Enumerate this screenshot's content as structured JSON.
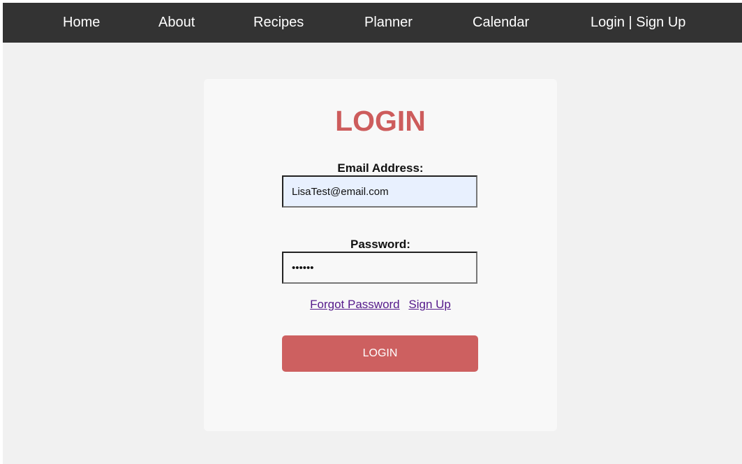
{
  "nav": {
    "items": [
      {
        "label": "Home"
      },
      {
        "label": "About"
      },
      {
        "label": "Recipes"
      },
      {
        "label": "Planner"
      },
      {
        "label": "Calendar"
      },
      {
        "label": "Login | Sign Up"
      }
    ]
  },
  "login": {
    "title": "LOGIN",
    "email_label": "Email Address:",
    "email_value": "LisaTest@email.com",
    "password_label": "Password:",
    "password_value": "••••••",
    "forgot_password": "Forgot Password",
    "sign_up": "Sign Up",
    "button_label": "LOGIN"
  },
  "colors": {
    "navbar_bg": "#333333",
    "page_bg": "#f1f1f1",
    "card_bg": "#f8f8f8",
    "accent": "#cd5c5c",
    "link": "#551a8b",
    "email_autofill_bg": "#e8f0fe"
  }
}
